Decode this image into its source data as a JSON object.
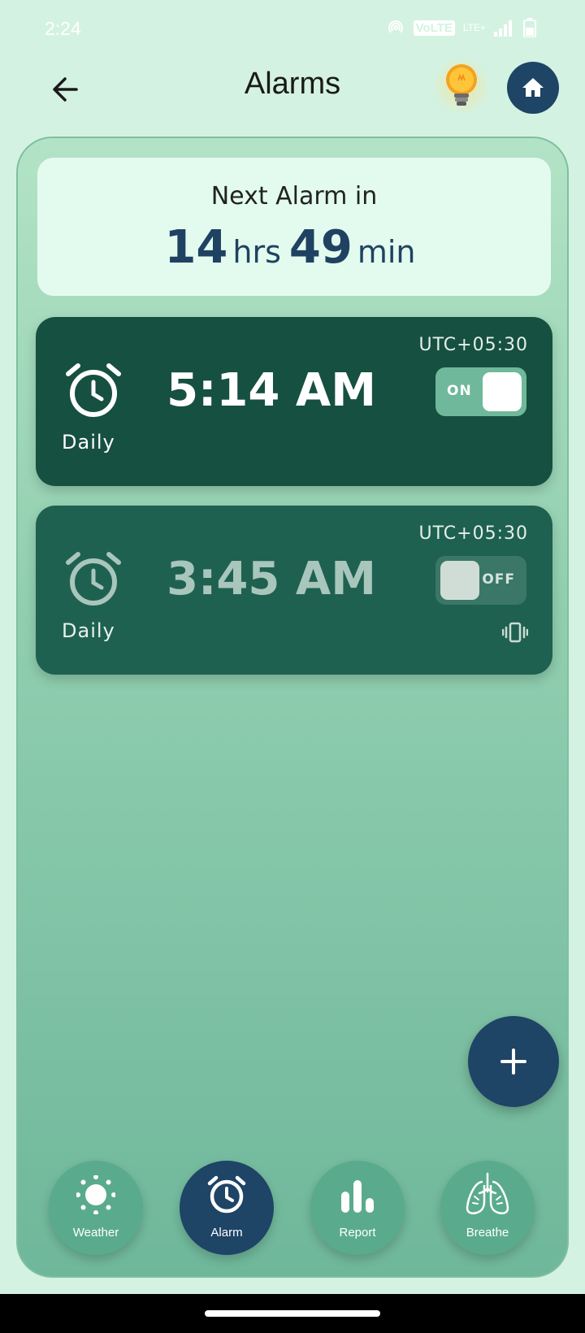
{
  "status_bar": {
    "time": "2:24",
    "volte": "VoLTE",
    "lte": "LTE+"
  },
  "header": {
    "title": "Alarms",
    "back_icon": "arrow-left-icon",
    "tip_icon": "lightbulb-icon",
    "home_icon": "home-icon"
  },
  "next_alarm": {
    "label": "Next Alarm in",
    "hours": "14",
    "hours_unit": "hrs",
    "minutes": "49",
    "minutes_unit": "min"
  },
  "alarms": [
    {
      "timezone": "UTC+05:30",
      "time": "5:14 AM",
      "repeat": "Daily",
      "toggle_label": "ON",
      "enabled": true
    },
    {
      "timezone": "UTC+05:30",
      "time": "3:45 AM",
      "repeat": "Daily",
      "toggle_label": "OFF",
      "enabled": false,
      "vibrate_icon": "vibrate-icon"
    }
  ],
  "fab": {
    "icon": "plus-icon"
  },
  "nav": [
    {
      "label": "Weather",
      "icon": "sun-icon",
      "active": false
    },
    {
      "label": "Alarm",
      "icon": "alarm-clock-icon",
      "active": true
    },
    {
      "label": "Report",
      "icon": "bar-chart-icon",
      "active": false
    },
    {
      "label": "Breathe",
      "icon": "lungs-icon",
      "active": false
    }
  ],
  "colors": {
    "background": "#d4f2e1",
    "navy": "#1e4466",
    "card_on": "#165040",
    "card_off": "#1f6150",
    "toggle_on": "#6fb89b"
  }
}
